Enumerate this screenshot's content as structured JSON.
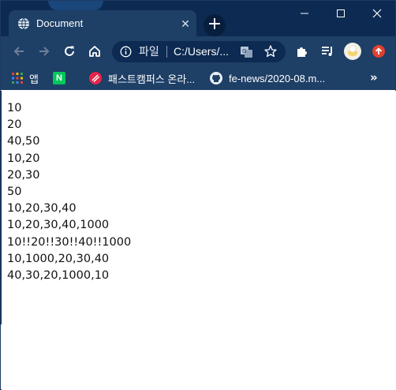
{
  "browser": {
    "tab": {
      "title": "Document",
      "favicon": "globe-icon",
      "close": "✕"
    },
    "new_tab": "+",
    "window_controls": {
      "minimize": "—",
      "maximize": "☐",
      "close": "✕"
    },
    "toolbar": {
      "back_icon": "arrow-left-icon",
      "forward_icon": "arrow-right-icon",
      "reload_icon": "reload-icon",
      "home_icon": "home-icon",
      "omnibox": {
        "scheme": "파일",
        "url": "C:/Users/..."
      },
      "translate_icon": "translate-icon",
      "bookmark_icon": "star-icon",
      "extensions_icon": "puzzle-icon",
      "media_icon": "media-queue-icon",
      "profile_icon": "avatar",
      "update_icon": "update-icon"
    },
    "bookmarks": [
      {
        "label": "앱",
        "icon": "apps-grid-icon"
      },
      {
        "label": "N",
        "icon": "naver-icon"
      },
      {
        "label": "패스트캠퍼스 온라...",
        "icon": "fastcampus-icon"
      },
      {
        "label": "fe-news/2020-08.m...",
        "icon": "github-icon"
      }
    ],
    "bookmarks_more": "»"
  },
  "page": {
    "lines": [
      "10",
      "20",
      "40,50",
      "10,20",
      "20,30",
      "50",
      "10,20,30,40",
      "10,20,30,40,1000",
      "10!!20!!30!!40!!1000",
      "10,1000,20,30,40",
      "40,30,20,1000,10"
    ]
  },
  "colors": {
    "frame": "#0c2a52",
    "toolbar": "#1e3f66",
    "omnibox": "#0c2a52",
    "content_bg": "#ffffff",
    "text": "#111111"
  }
}
